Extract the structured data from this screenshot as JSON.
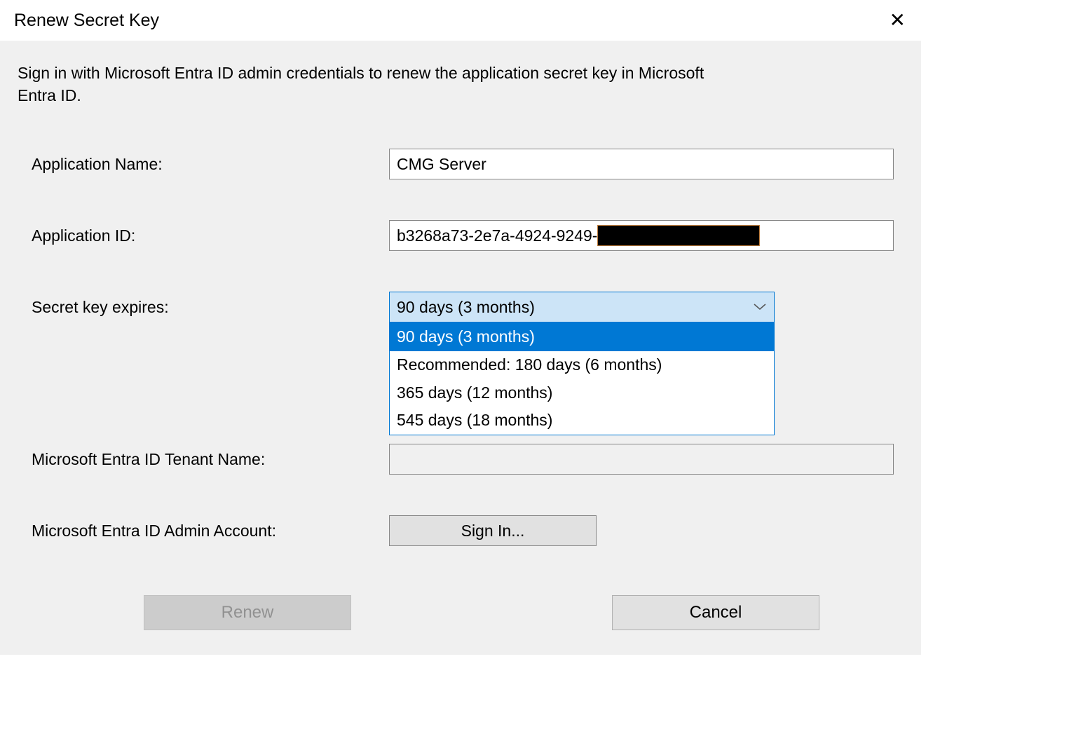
{
  "window": {
    "title": "Renew Secret Key"
  },
  "description": "Sign in with Microsoft Entra ID admin credentials to renew the application secret key in Microsoft Entra ID.",
  "form": {
    "appName": {
      "label": "Application Name:",
      "value": "CMG Server"
    },
    "appId": {
      "label": "Application ID:",
      "value": "b3268a73-2e7a-4924-9249-"
    },
    "expiry": {
      "label": "Secret key expires:",
      "selected": "90 days (3 months)",
      "options": [
        "90 days (3 months)",
        "Recommended: 180 days (6 months)",
        "365 days (12 months)",
        "545 days (18 months)"
      ]
    },
    "tenant": {
      "label": "Microsoft Entra ID Tenant Name:"
    },
    "admin": {
      "label": "Microsoft Entra ID Admin Account:",
      "button": "Sign In..."
    }
  },
  "buttons": {
    "renew": "Renew",
    "cancel": "Cancel"
  }
}
